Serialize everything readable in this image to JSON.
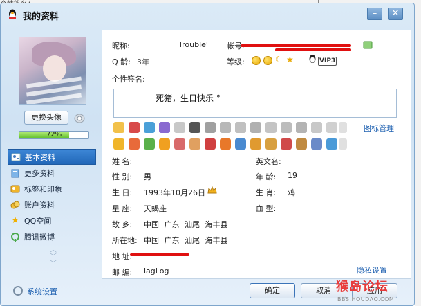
{
  "window": {
    "title": "我的资料",
    "bg_fragment": "个性签名："
  },
  "profile": {
    "change_avatar_label": "更换头像",
    "progress": 0.72,
    "progress_label": "72%"
  },
  "nav": [
    {
      "label": "基本资料",
      "icon": "person-card-icon",
      "active": true
    },
    {
      "label": "更多资料",
      "icon": "book-icon",
      "active": false
    },
    {
      "label": "标签和印象",
      "icon": "tag-icon",
      "active": false
    },
    {
      "label": "账户资料",
      "icon": "coins-icon",
      "active": false
    },
    {
      "label": "QQ空间",
      "icon": "star-icon",
      "active": false
    },
    {
      "label": "腾讯微博",
      "icon": "weibo-icon",
      "active": false
    }
  ],
  "basic": {
    "nickname_label": "昵称:",
    "nickname": "Trouble'",
    "account_label": "帐号:",
    "qq_age_label": "Q 龄:",
    "qq_age": "3年",
    "level_label": "等级:",
    "vip_badge": "VIP3",
    "signature_label": "个性签名:",
    "signature": "死猪，生日快乐 °"
  },
  "icons_manage_label": "图标管理",
  "details": {
    "name_label": "姓    名:",
    "english_name_label": "英文名:",
    "gender_label": "性    别:",
    "gender": "男",
    "age_label": "年    龄:",
    "age": "19",
    "birthday_label": "生    日:",
    "birthday": "1993年10月26日",
    "zodiac_label": "生    肖:",
    "zodiac": "鸡",
    "constellation_label": "星    座:",
    "constellation": "天蝎座",
    "blood_label": "血    型:",
    "hometown_label": "故    乡:",
    "hometown": "中国  广东  汕尾  海丰县",
    "location_label": "所在地:",
    "location": "中国  广东  汕尾  海丰县",
    "address_label": "地    址:",
    "postcode_label": "邮    编:",
    "postcode": "lagLog"
  },
  "privacy_label": "隐私设置",
  "footer": {
    "settings_label": "系统设置",
    "ok_label": "确定",
    "cancel_label": "取消",
    "apply_label": "应用"
  },
  "watermark": {
    "title": "猴岛论坛",
    "sub": "BBS.HOUDAO.COM"
  },
  "colors": {
    "accent": "#2167b8",
    "link": "#1c5fb0",
    "redact": "#e01010"
  }
}
